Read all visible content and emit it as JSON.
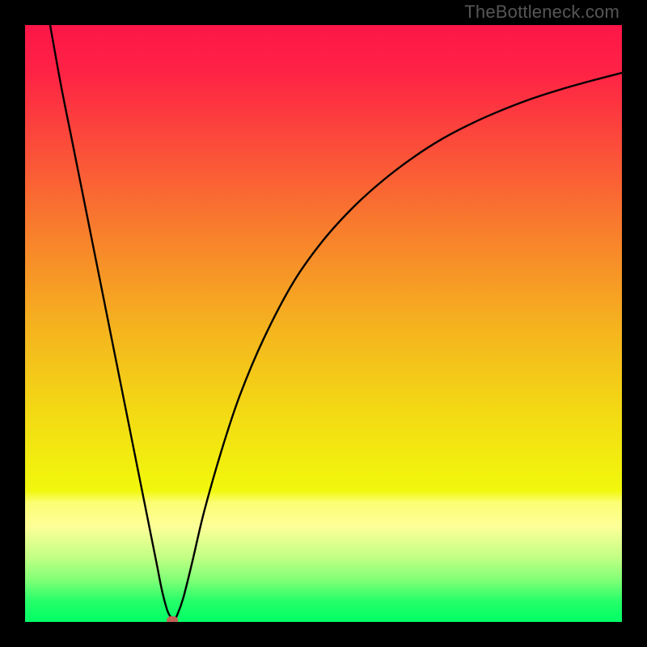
{
  "watermark": "TheBottleneck.com",
  "colors": {
    "bg_black": "#000000",
    "marker": "#c26055",
    "curve": "#000000"
  },
  "chart_data": {
    "type": "line",
    "title": "",
    "xlabel": "",
    "ylabel": "",
    "xlim": [
      0,
      100
    ],
    "ylim": [
      0,
      100
    ],
    "gradient_stops": [
      {
        "pos": 0.0,
        "color": "#fe1648"
      },
      {
        "pos": 0.08,
        "color": "#fe2345"
      },
      {
        "pos": 0.2,
        "color": "#fb4c3a"
      },
      {
        "pos": 0.35,
        "color": "#f8802c"
      },
      {
        "pos": 0.5,
        "color": "#f5b11f"
      },
      {
        "pos": 0.65,
        "color": "#f3da14"
      },
      {
        "pos": 0.78,
        "color": "#f1f80c"
      },
      {
        "pos": 0.8,
        "color": "#fcfe74"
      },
      {
        "pos": 0.84,
        "color": "#fdff98"
      },
      {
        "pos": 0.89,
        "color": "#c4ff85"
      },
      {
        "pos": 0.93,
        "color": "#80ff76"
      },
      {
        "pos": 0.965,
        "color": "#26fe69"
      },
      {
        "pos": 1.0,
        "color": "#00fe65"
      }
    ],
    "series": [
      {
        "name": "bottleneck-curve",
        "points": [
          {
            "x": 4.2,
            "y": 100.0
          },
          {
            "x": 6.0,
            "y": 90.0
          },
          {
            "x": 8.0,
            "y": 80.0
          },
          {
            "x": 10.0,
            "y": 70.0
          },
          {
            "x": 12.0,
            "y": 60.0
          },
          {
            "x": 14.0,
            "y": 50.0
          },
          {
            "x": 16.0,
            "y": 40.0
          },
          {
            "x": 18.0,
            "y": 30.0
          },
          {
            "x": 20.0,
            "y": 20.0
          },
          {
            "x": 22.0,
            "y": 10.0
          },
          {
            "x": 23.0,
            "y": 5.0
          },
          {
            "x": 24.0,
            "y": 1.5
          },
          {
            "x": 25.0,
            "y": 0.5
          },
          {
            "x": 25.5,
            "y": 1.2
          },
          {
            "x": 26.5,
            "y": 4.0
          },
          {
            "x": 28.0,
            "y": 10.0
          },
          {
            "x": 30.0,
            "y": 18.5
          },
          {
            "x": 33.0,
            "y": 29.0
          },
          {
            "x": 36.0,
            "y": 38.0
          },
          {
            "x": 40.0,
            "y": 47.5
          },
          {
            "x": 45.0,
            "y": 57.0
          },
          {
            "x": 50.0,
            "y": 64.0
          },
          {
            "x": 55.0,
            "y": 69.5
          },
          {
            "x": 60.0,
            "y": 74.0
          },
          {
            "x": 65.0,
            "y": 77.8
          },
          {
            "x": 70.0,
            "y": 81.0
          },
          {
            "x": 75.0,
            "y": 83.6
          },
          {
            "x": 80.0,
            "y": 85.8
          },
          {
            "x": 85.0,
            "y": 87.7
          },
          {
            "x": 90.0,
            "y": 89.3
          },
          {
            "x": 95.0,
            "y": 90.7
          },
          {
            "x": 100.0,
            "y": 92.0
          }
        ]
      }
    ],
    "marker": {
      "x": 24.6,
      "y": 0.3
    }
  }
}
